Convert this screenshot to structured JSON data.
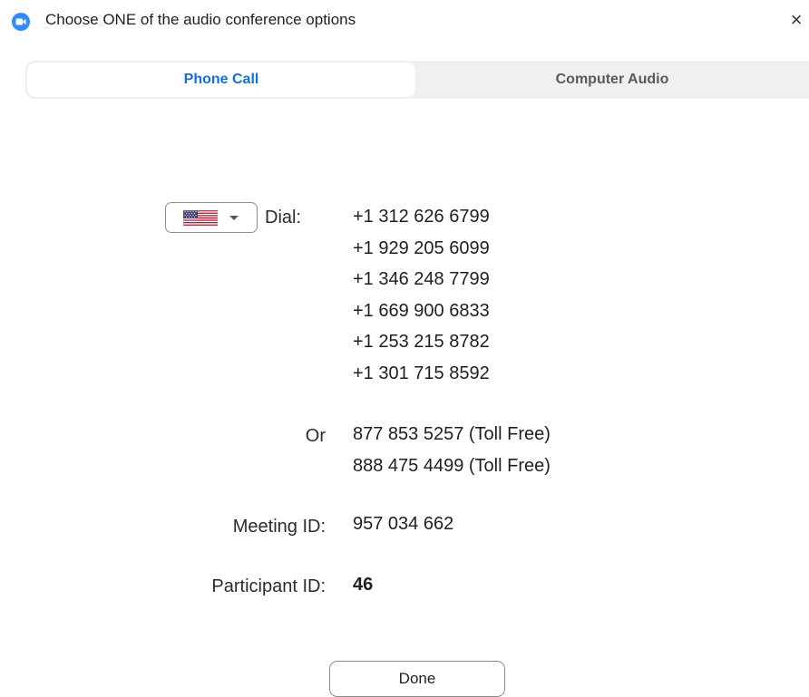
{
  "window": {
    "title": "Choose ONE of the audio conference options",
    "close_symbol": "×",
    "app_icon": "zoom-camera-icon",
    "brand_color": "#2d8cff"
  },
  "tabs": [
    {
      "label": "Phone Call",
      "active": true
    },
    {
      "label": "Computer Audio",
      "active": false
    }
  ],
  "phone_call": {
    "country_selector": {
      "flag": "us-flag-icon",
      "chevron": "chevron-down-icon"
    },
    "dial_label": "Dial:",
    "dial_numbers": [
      "+1 312 626 6799",
      "+1 929 205 6099",
      "+1 346 248 7799",
      "+1 669 900 6833",
      "+1 253 215 8782",
      "+1 301 715 8592"
    ],
    "or_label": "Or",
    "toll_free_numbers": [
      "877 853 5257 (Toll Free)",
      "888 475 4499 (Toll Free)"
    ],
    "meeting_id_label": "Meeting ID:",
    "meeting_id": "957 034 662",
    "participant_id_label": "Participant ID:",
    "participant_id": "46"
  },
  "footer": {
    "done_label": "Done"
  },
  "colors": {
    "active_tab_text": "#0e71eb",
    "tab_bar_bg": "#f0f0f3"
  }
}
